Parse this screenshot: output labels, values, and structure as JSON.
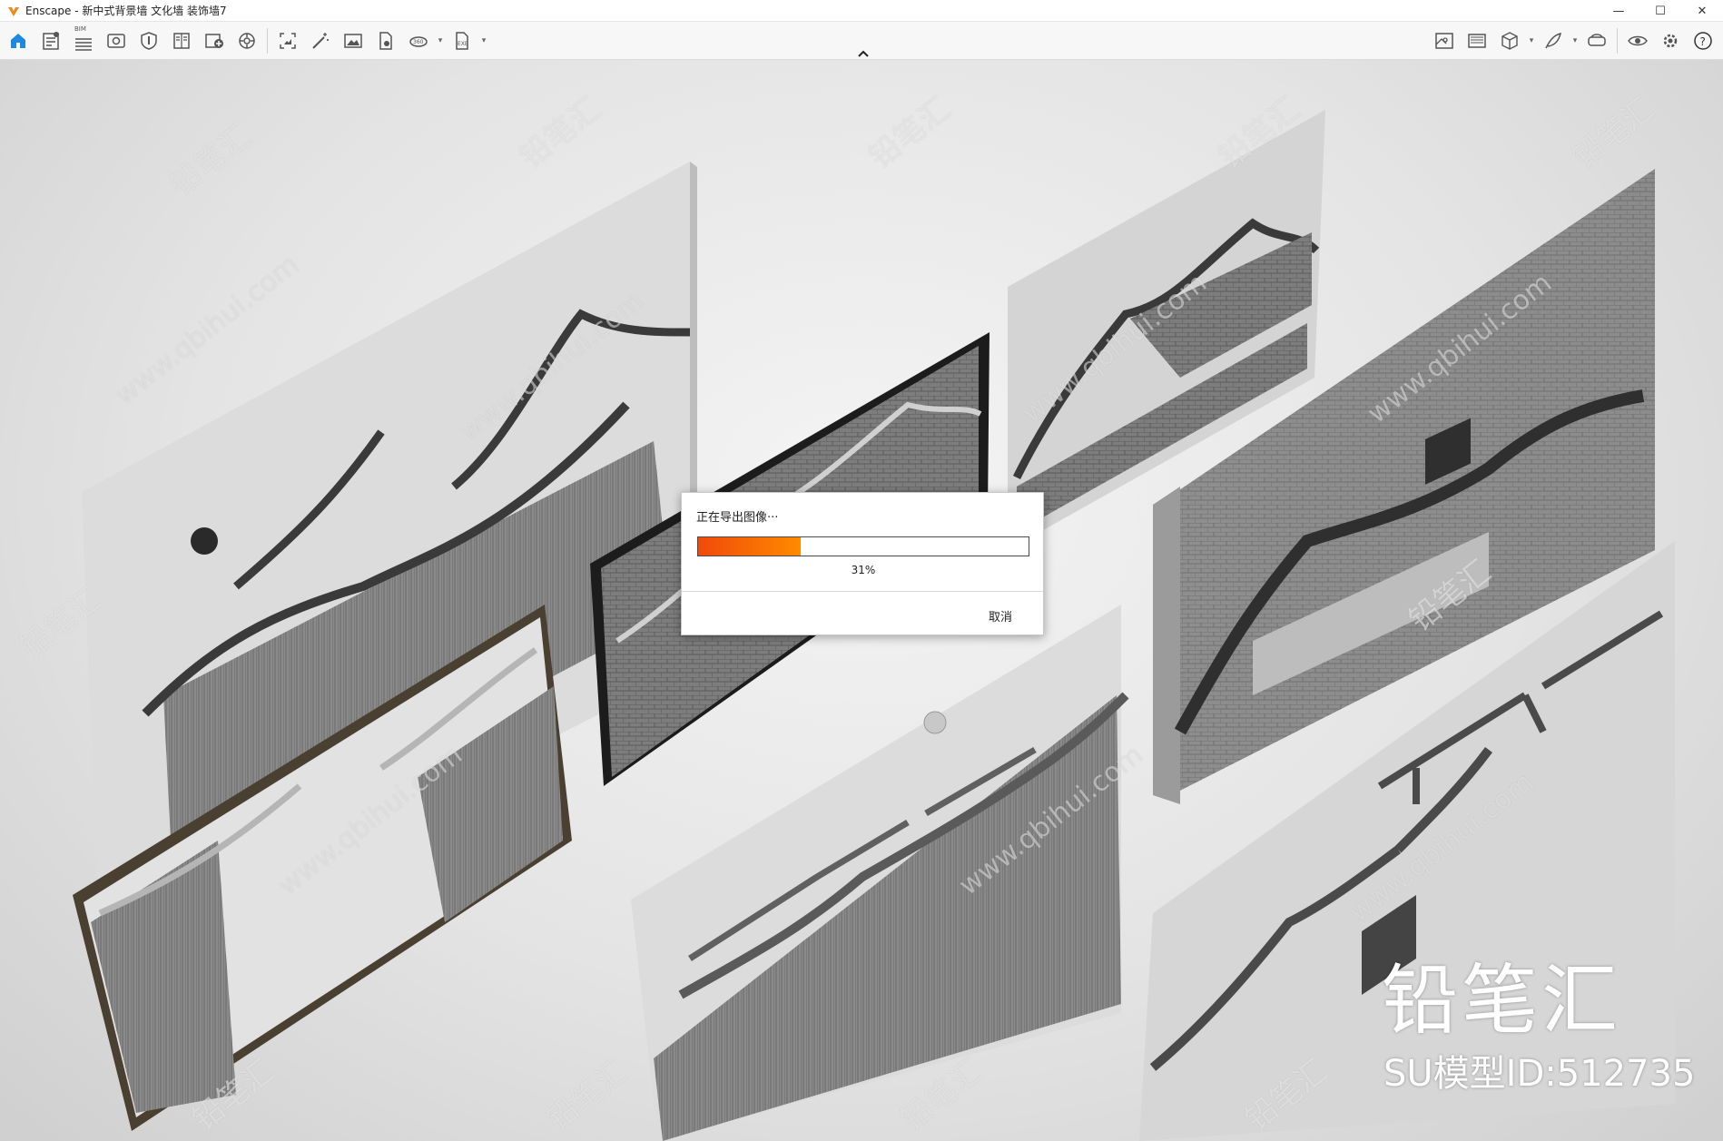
{
  "window": {
    "title": "Enscape - 新中式背景墙 文化墙 装饰墙7",
    "controls": {
      "minimize": "—",
      "maximize": "☐",
      "close": "✕"
    }
  },
  "toolbar": {
    "bim_tag": "BIM",
    "left_icons": [
      "home-icon",
      "asset-library-icon",
      "bim-icon",
      "view-icon",
      "shield-icon",
      "book-icon",
      "image-upload-icon",
      "settings-wheel-icon",
      "screenshot-icon",
      "magic-wand-icon",
      "image-icon",
      "document-icon",
      "panorama-360-icon",
      "export-exe-icon"
    ],
    "right_icons": [
      "map-icon",
      "gallery-icon",
      "cube-icon",
      "feather-icon",
      "vr-headset-icon",
      "eye-icon",
      "settings-icon",
      "help-icon"
    ]
  },
  "dialog": {
    "title": "正在导出图像···",
    "progress": 31,
    "progress_label": "31%",
    "cancel_label": "取消",
    "accent": "#f26a0c"
  },
  "watermark": {
    "brand": "铅笔汇",
    "model_id": "SU模型ID:512735",
    "repeat_text": "铅笔汇",
    "repeat_url": "www.qbihui.com"
  }
}
